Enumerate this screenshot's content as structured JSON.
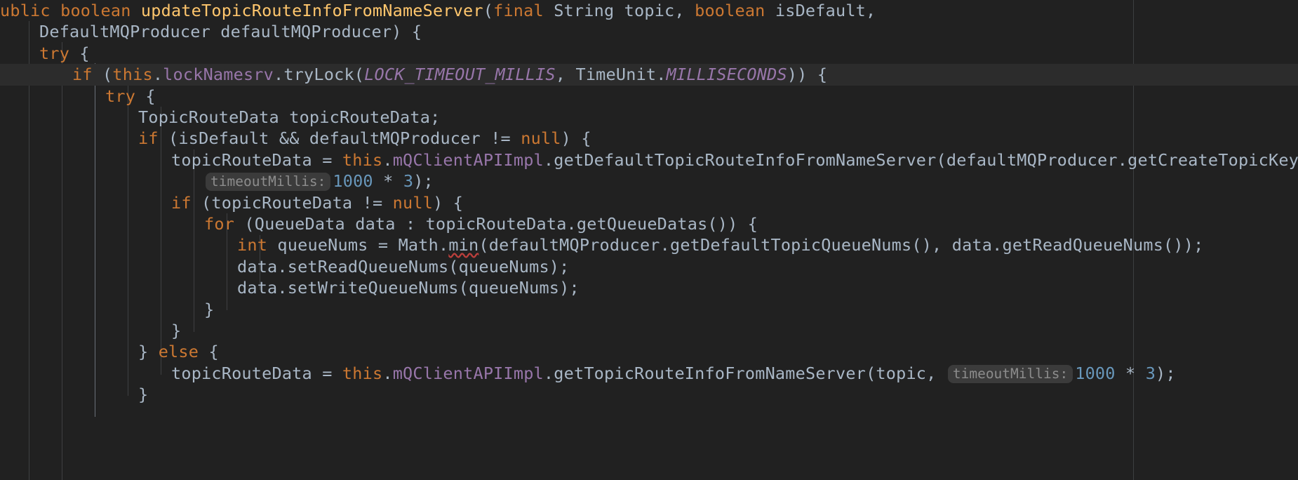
{
  "app": {
    "kind": "code-editor",
    "theme": "darcula-dark",
    "language": "Java",
    "background_color": "#212121",
    "current_line_color": "#2c2c2c",
    "margin_guide_color": "#3c3f41",
    "indent_guide_color": "#3f4042",
    "active_indent_guide_color": "#6b7279"
  },
  "palette": {
    "default_text": "#a9b7c6",
    "keyword": "#cc7832",
    "method_declaration": "#ffc66d",
    "field": "#9876aa",
    "static_constant": "#9876aa",
    "number": "#6897bb",
    "inlay_hint_text": "#8c8c8c",
    "inlay_hint_background": "#3b3b3b",
    "error_squiggle": "#bc3f3c"
  },
  "editor": {
    "current_line_index": 3,
    "margin_guide_x": 1615,
    "lines": [
      {
        "index": 0,
        "indent": 0,
        "clipped_left": true,
        "tokens": [
          {
            "text": "ublic",
            "kind": "keyword"
          },
          {
            "text": " ",
            "kind": "plain"
          },
          {
            "text": "boolean",
            "kind": "keyword"
          },
          {
            "text": " ",
            "kind": "plain"
          },
          {
            "text": "updateTopicRouteInfoFromNameServer",
            "kind": "method_declaration"
          },
          {
            "text": "(",
            "kind": "plain"
          },
          {
            "text": "final",
            "kind": "keyword"
          },
          {
            "text": " String topic, ",
            "kind": "plain"
          },
          {
            "text": "boolean",
            "kind": "keyword"
          },
          {
            "text": " isDefault,",
            "kind": "plain"
          }
        ]
      },
      {
        "index": 1,
        "indent": 1,
        "tokens": [
          {
            "text": "DefaultMQProducer defaultMQProducer) {",
            "kind": "plain"
          }
        ]
      },
      {
        "index": 2,
        "indent": 1,
        "tokens": [
          {
            "text": "try",
            "kind": "keyword"
          },
          {
            "text": " {",
            "kind": "plain"
          }
        ]
      },
      {
        "index": 3,
        "indent": 2,
        "current": true,
        "tokens": [
          {
            "text": "if",
            "kind": "keyword"
          },
          {
            "text": " (",
            "kind": "plain"
          },
          {
            "text": "this",
            "kind": "keyword"
          },
          {
            "text": ".",
            "kind": "plain"
          },
          {
            "text": "lockNamesrv",
            "kind": "field"
          },
          {
            "text": ".tryLock(",
            "kind": "plain"
          },
          {
            "text": "LOCK_TIMEOUT_MILLIS",
            "kind": "static_constant"
          },
          {
            "text": ", ",
            "kind": "plain"
          },
          {
            "text": "TimeUnit.",
            "kind": "plain"
          },
          {
            "text": "MILLISECONDS",
            "kind": "static_constant"
          },
          {
            "text": ")) {",
            "kind": "plain"
          }
        ]
      },
      {
        "index": 4,
        "indent": 3,
        "tokens": [
          {
            "text": "try",
            "kind": "keyword"
          },
          {
            "text": " {",
            "kind": "plain"
          }
        ]
      },
      {
        "index": 5,
        "indent": 4,
        "tokens": [
          {
            "text": "TopicRouteData topicRouteData;",
            "kind": "plain"
          }
        ]
      },
      {
        "index": 6,
        "indent": 4,
        "tokens": [
          {
            "text": "if",
            "kind": "keyword"
          },
          {
            "text": " (isDefault && defaultMQProducer != ",
            "kind": "plain"
          },
          {
            "text": "null",
            "kind": "keyword"
          },
          {
            "text": ") {",
            "kind": "plain"
          }
        ]
      },
      {
        "index": 7,
        "indent": 5,
        "tokens": [
          {
            "text": "topicRouteData = ",
            "kind": "plain"
          },
          {
            "text": "this",
            "kind": "keyword"
          },
          {
            "text": ".",
            "kind": "plain"
          },
          {
            "text": "mQClientAPIImpl",
            "kind": "field"
          },
          {
            "text": ".getDefaultTopicRouteInfoFromNameServer(defaultMQProducer.getCreateTopicKey(",
            "kind": "plain"
          }
        ]
      },
      {
        "index": 8,
        "indent": 6,
        "hint_prefix": "timeoutMillis:",
        "tokens": [
          {
            "text": "1000",
            "kind": "number"
          },
          {
            "text": " * ",
            "kind": "plain"
          },
          {
            "text": "3",
            "kind": "number"
          },
          {
            "text": ");",
            "kind": "plain"
          }
        ]
      },
      {
        "index": 9,
        "indent": 5,
        "tokens": [
          {
            "text": "if",
            "kind": "keyword"
          },
          {
            "text": " (topicRouteData != ",
            "kind": "plain"
          },
          {
            "text": "null",
            "kind": "keyword"
          },
          {
            "text": ") {",
            "kind": "plain"
          }
        ]
      },
      {
        "index": 10,
        "indent": 6,
        "tokens": [
          {
            "text": "for",
            "kind": "keyword"
          },
          {
            "text": " (QueueData data : topicRouteData.getQueueDatas()) {",
            "kind": "plain"
          }
        ]
      },
      {
        "index": 11,
        "indent": 7,
        "tokens": [
          {
            "text": "int",
            "kind": "keyword"
          },
          {
            "text": " queueNums = Math.",
            "kind": "plain"
          },
          {
            "text": "min",
            "kind": "static_error"
          },
          {
            "text": "(defaultMQProducer.getDefaultTopicQueueNums(), data.getReadQueueNums());",
            "kind": "plain"
          }
        ]
      },
      {
        "index": 12,
        "indent": 7,
        "tokens": [
          {
            "text": "data.setReadQueueNums(queueNums);",
            "kind": "plain"
          }
        ]
      },
      {
        "index": 13,
        "indent": 7,
        "tokens": [
          {
            "text": "data.setWriteQueueNums(queueNums);",
            "kind": "plain"
          }
        ]
      },
      {
        "index": 14,
        "indent": 6,
        "tokens": [
          {
            "text": "}",
            "kind": "plain"
          }
        ]
      },
      {
        "index": 15,
        "indent": 5,
        "tokens": [
          {
            "text": "}",
            "kind": "plain"
          }
        ]
      },
      {
        "index": 16,
        "indent": 4,
        "tokens": [
          {
            "text": "} ",
            "kind": "plain"
          },
          {
            "text": "else",
            "kind": "keyword"
          },
          {
            "text": " {",
            "kind": "plain"
          }
        ]
      },
      {
        "index": 17,
        "indent": 5,
        "tokens": [
          {
            "text": "topicRouteData = ",
            "kind": "plain"
          },
          {
            "text": "this",
            "kind": "keyword"
          },
          {
            "text": ".",
            "kind": "plain"
          },
          {
            "text": "mQClientAPIImpl",
            "kind": "field"
          },
          {
            "text": ".getTopicRouteInfoFromNameServer(topic, ",
            "kind": "plain"
          },
          {
            "text": "timeoutMillis:",
            "kind": "inlay_hint"
          },
          {
            "text": "1000",
            "kind": "number"
          },
          {
            "text": " * ",
            "kind": "plain"
          },
          {
            "text": "3",
            "kind": "number"
          },
          {
            "text": ");",
            "kind": "plain"
          }
        ]
      },
      {
        "index": 18,
        "indent": 4,
        "tokens": [
          {
            "text": "}",
            "kind": "plain"
          }
        ]
      }
    ]
  }
}
